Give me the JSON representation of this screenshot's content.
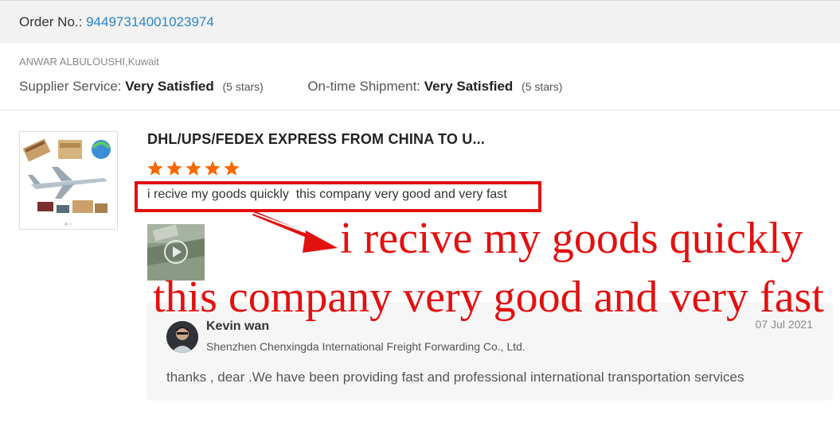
{
  "order": {
    "label": "Order No.:",
    "number": "94497314001023974"
  },
  "buyer": {
    "name": "ANWAR ALBULOUSHI,Kuwait"
  },
  "ratings": {
    "supplier_label": "Supplier Service:",
    "supplier_value": "Very Satisfied",
    "supplier_stars": "(5 stars)",
    "shipment_label": "On-time Shipment:",
    "shipment_value": "Very Satisfied",
    "shipment_stars": "(5 stars)"
  },
  "product": {
    "title": "DHL/UPS/FEDEX EXPRESS FROM CHINA TO U...",
    "rating": 5,
    "rating_max": 5,
    "star_color": "#f56a00"
  },
  "review": {
    "text": "i recive my goods quickly  this company very good and very fast"
  },
  "reply": {
    "name": "Kevin wan",
    "company": "Shenzhen Chenxingda International Freight Forwarding Co., Ltd.",
    "date": "07 Jul 2021",
    "text": "thanks , dear .We have been providing fast and professional international transportation services"
  },
  "annotation": {
    "line1": "i recive my goods quickly",
    "line2": "this company very good and very fast",
    "color": "#e31010"
  },
  "colors": {
    "link": "#2b86c9",
    "header_bg": "#f2f2f2",
    "card_bg": "#f6f6f6"
  },
  "icons": [
    "star-icon",
    "play-icon"
  ]
}
